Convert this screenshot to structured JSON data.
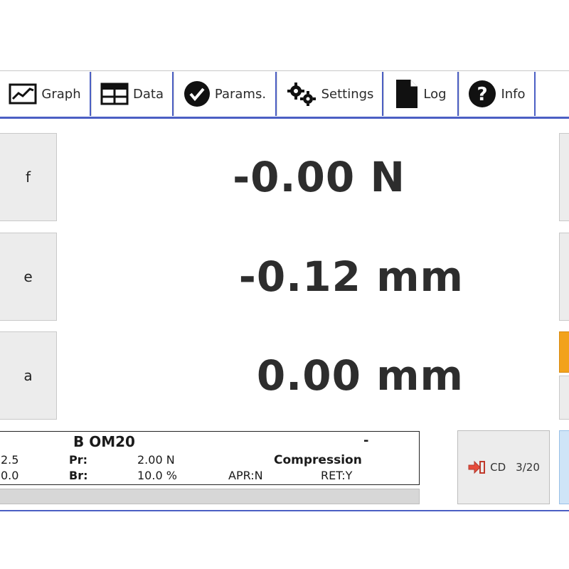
{
  "tabs": [
    {
      "label": "Graph",
      "icon": "chart-icon"
    },
    {
      "label": "Data",
      "icon": "table-icon"
    },
    {
      "label": "Params.",
      "icon": "check-circle-icon"
    },
    {
      "label": "Settings",
      "icon": "gears-icon"
    },
    {
      "label": "Log",
      "icon": "document-icon"
    },
    {
      "label": "Info",
      "icon": "question-icon"
    }
  ],
  "side_keys": [
    "f",
    "e",
    "a"
  ],
  "readings": [
    "-0.00 N",
    "-0.12 mm",
    "0.00 mm"
  ],
  "panel": {
    "title": "B OM20",
    "dash": "-",
    "left_val_1": "2.5",
    "left_val_2": "0.0",
    "pr_label": "Pr:",
    "pr_value": "2.00 N",
    "br_label": "Br:",
    "br_value": "10.0 %",
    "mode": "Compression",
    "apr": "APR:N",
    "ret": "RET:Y"
  },
  "cd_button": {
    "label": "CD",
    "count": "3/20"
  },
  "colors": {
    "accent": "#4b5fc4",
    "orange": "#f2a21b",
    "key_bg": "#ececec"
  }
}
